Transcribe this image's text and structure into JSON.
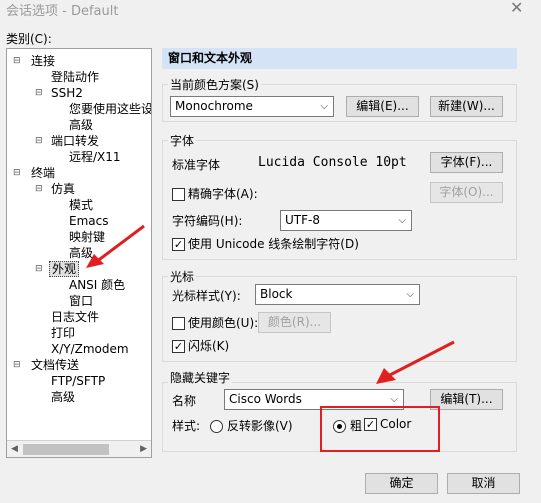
{
  "window": {
    "title": "会话选项 - Default",
    "close_glyph": "✕"
  },
  "sidebar": {
    "label": "类别(C):",
    "items": [
      "连接",
      "登陆动作",
      "SSH2",
      "您要使用这些设",
      "高级",
      "端口转发",
      "远程/X11",
      "终端",
      "仿真",
      "模式",
      "Emacs",
      "映射键",
      "高级",
      "外观",
      "ANSI 颜色",
      "窗口",
      "日志文件",
      "打印",
      "X/Y/Zmodem",
      "文档传送",
      "FTP/SFTP",
      "高级"
    ]
  },
  "panel": {
    "title": "窗口和文本外观",
    "color_scheme": {
      "label": "当前颜色方案(S)",
      "value": "Monochrome",
      "edit": "编辑(E)...",
      "new": "新建(W)..."
    },
    "font": {
      "label": "字体",
      "standard_label": "标准字体",
      "standard_value": "Lucida Console 10pt",
      "font_btn": "字体(F)...",
      "precise_label": "精确字体(A):",
      "precise_btn": "字体(O)...",
      "encoding_label": "字符编码(H):",
      "encoding_value": "UTF-8",
      "unicode_label": "使用 Unicode 线条绘制字符(D)"
    },
    "cursor": {
      "label": "光标",
      "style_label": "光标样式(Y):",
      "style_value": "Block",
      "use_color_label": "使用颜色(U):",
      "color_btn": "颜色(R)...",
      "blink_label": "闪烁(K)"
    },
    "keywords": {
      "label": "隐藏关键字",
      "name_label": "名称",
      "name_value": "Cisco Words",
      "edit": "编辑(T)...",
      "style_label": "样式:",
      "reverse_label": "反转影像(V)",
      "bold_label": "粗",
      "color_label": "Color"
    }
  },
  "footer": {
    "ok": "确定",
    "cancel": "取消"
  },
  "colors": {
    "header_bg": "#d5e3f7",
    "annotation": "#e02020"
  }
}
